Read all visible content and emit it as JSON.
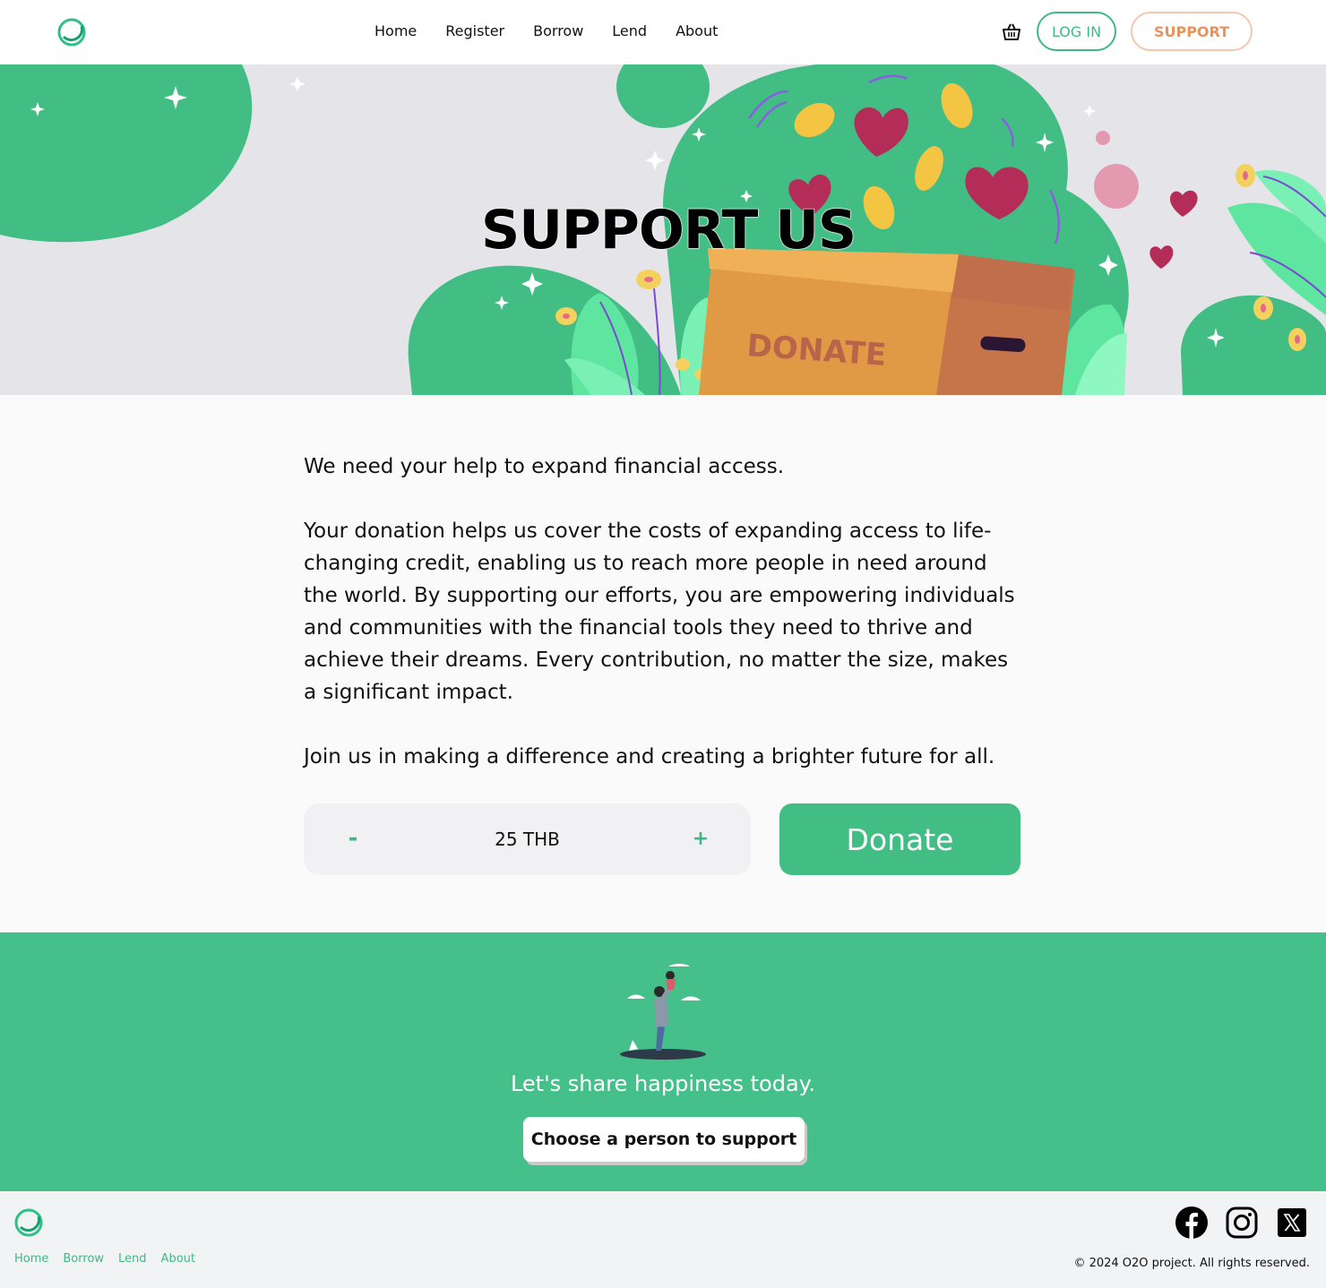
{
  "header": {
    "nav": [
      "Home",
      "Register",
      "Borrow",
      "Lend",
      "About"
    ],
    "login_label": "LOG IN",
    "support_label": "SUPPORT"
  },
  "hero": {
    "title": "SUPPORT US",
    "box_label": "DONATE"
  },
  "content": {
    "paragraphs": [
      "We need your help to expand financial access.",
      "Your donation helps us cover the costs of expanding access to life-changing credit, enabling us to reach more people in need around the world. By supporting our efforts, you are empowering individuals and communities with the financial tools they need to thrive and achieve their dreams. Every contribution, no matter the size, makes a significant impact.",
      "Join us in making a difference and creating a brighter future for all."
    ],
    "stepper": {
      "minus": "-",
      "value": "25 THB",
      "plus": "+"
    },
    "donate_label": "Donate"
  },
  "cta": {
    "text": "Let's share happiness today.",
    "button_label": "Choose a person to support"
  },
  "footer": {
    "links": [
      "Home",
      "Borrow",
      "Lend",
      "About"
    ],
    "copyright": "© 2024 O2O project. All rights reserved."
  },
  "colors": {
    "brand_green": "#42bd84",
    "accent_orange": "#e8925e",
    "hero_bg": "#e5e5e9"
  },
  "icons": [
    "logo-ring-icon",
    "cart-icon",
    "facebook-icon",
    "instagram-icon",
    "x-icon"
  ]
}
